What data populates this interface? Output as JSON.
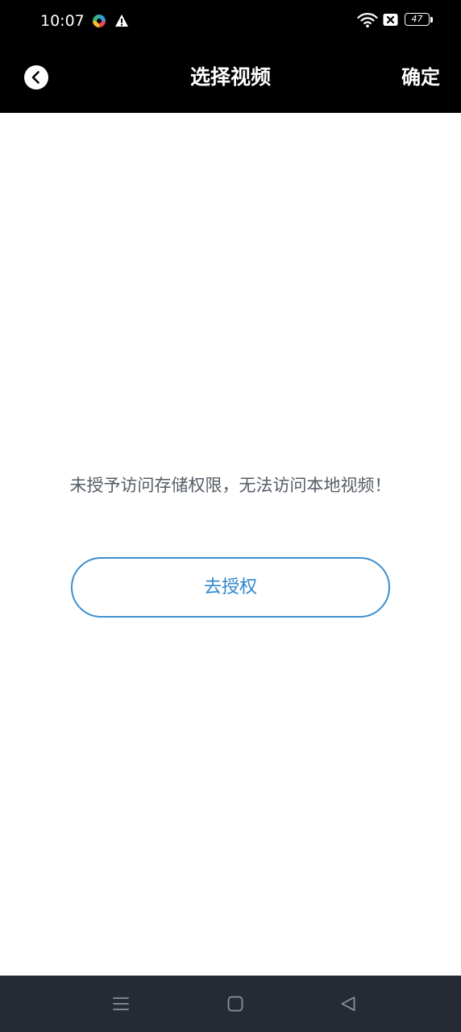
{
  "status_bar": {
    "time": "10:07",
    "battery_level": "47",
    "icons": [
      "app-notification-icon",
      "warning-icon",
      "wifi-icon",
      "sim-icon",
      "battery-icon"
    ]
  },
  "header": {
    "title": "选择视频",
    "confirm_label": "确定",
    "back_icon": "chevron-left-icon"
  },
  "content": {
    "message": "未授予访问存储权限，无法访问本地视频！",
    "authorize_label": "去授权"
  },
  "navigation_bar": {
    "icons": [
      "menu-icon",
      "home-icon",
      "back-triangle-icon"
    ]
  },
  "colors": {
    "header_background": "#000000",
    "page_background": "#ffffff",
    "accent": "#2f86cc",
    "message_text": "#555c66",
    "navbar_background": "#252a33"
  }
}
